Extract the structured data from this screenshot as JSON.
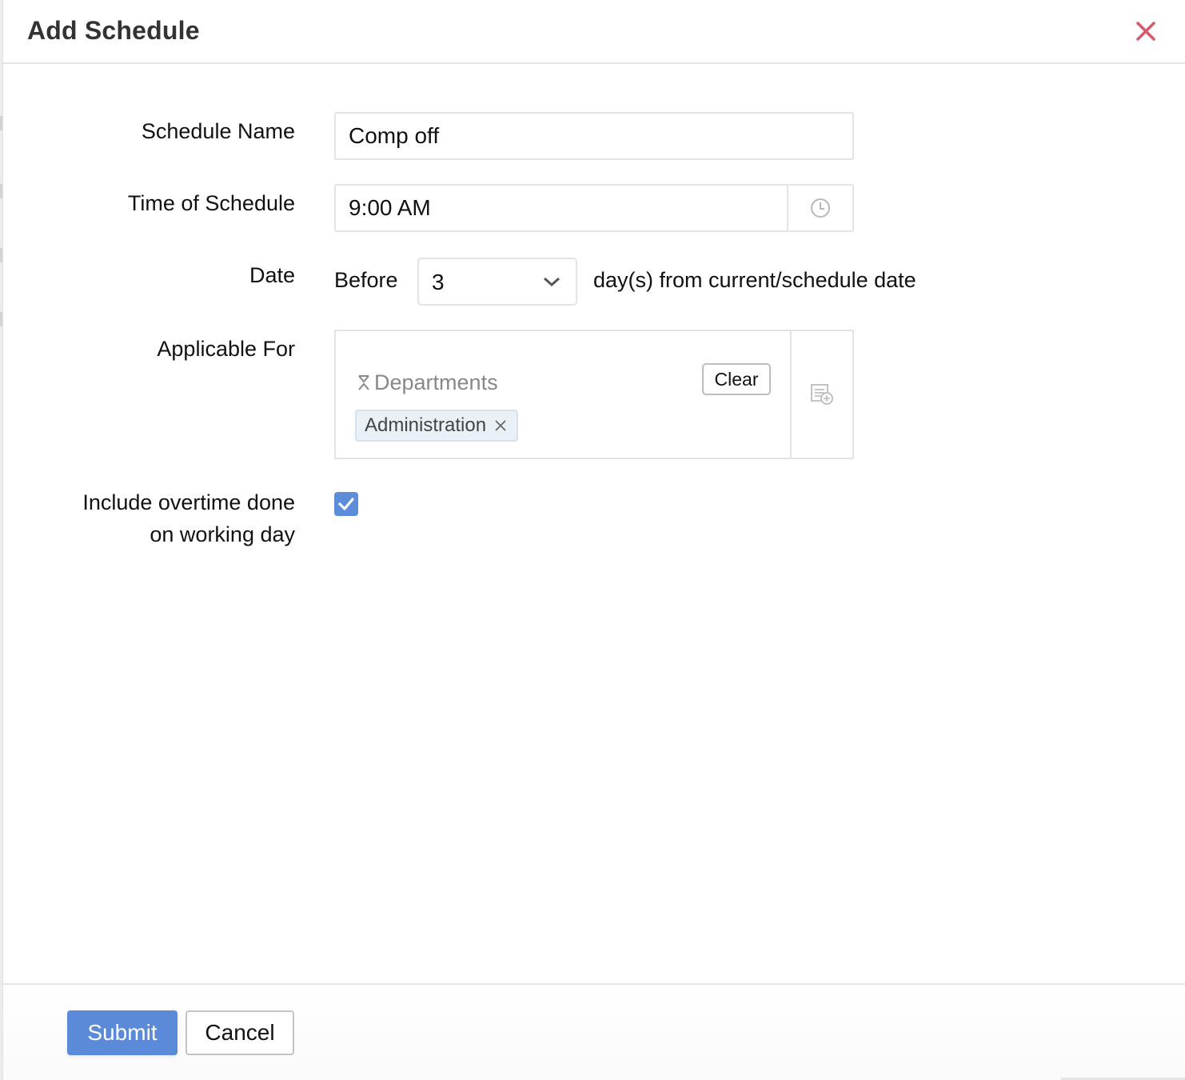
{
  "dialog": {
    "title": "Add Schedule",
    "close_icon": "close-icon"
  },
  "form": {
    "schedule_name": {
      "label": "Schedule Name",
      "value": "Comp off"
    },
    "time_of_schedule": {
      "label": "Time of Schedule",
      "value": "9:00 AM",
      "icon": "clock-icon"
    },
    "date": {
      "label": "Date",
      "prefix": "Before",
      "selected": "3",
      "suffix": "day(s) from current/schedule date",
      "icon": "chevron-down-icon"
    },
    "applicable_for": {
      "label": "Applicable For",
      "group_label": "Departments",
      "clear_label": "Clear",
      "chips": [
        {
          "label": "Administration"
        }
      ],
      "picker_icon": "list-add-icon"
    },
    "include_overtime": {
      "label_line1": "Include overtime done",
      "label_line2": "on working day",
      "checked": true
    }
  },
  "footer": {
    "submit_label": "Submit",
    "cancel_label": "Cancel"
  },
  "colors": {
    "primary": "#5a8ad8",
    "close": "#d9576a",
    "chip_bg": "#e9f0f6",
    "checkbox": "#5b8dd9"
  }
}
